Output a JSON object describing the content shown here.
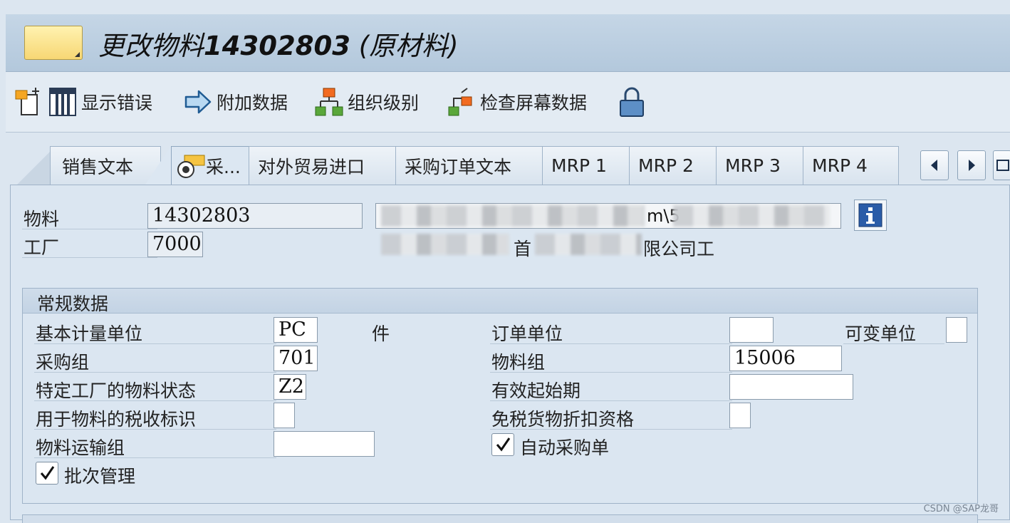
{
  "title": {
    "prefix": "更改物料",
    "material": "14302803",
    "suffix": "(原材料)"
  },
  "toolbar": {
    "show_errors": "显示错误",
    "additional_data": "附加数据",
    "org_levels": "组织级别",
    "check_screen": "检查屏幕数据"
  },
  "tabs": [
    "销售文本",
    "采...",
    "对外贸易进口",
    "采购订单文本",
    "MRP 1",
    "MRP 2",
    "MRP 3",
    "MRP 4"
  ],
  "header": {
    "material_label": "物料",
    "material_value": "14302803",
    "plant_label": "工厂",
    "plant_value": "7000",
    "desc_tail": "m\\5",
    "plant_desc_left": "首",
    "plant_desc_tail": "限公司工"
  },
  "general": {
    "title": "常规数据",
    "base_uom_label": "基本计量单位",
    "base_uom_value": "PC",
    "base_uom_text": "件",
    "order_unit_label": "订单单位",
    "order_unit_value": "",
    "var_unit_label": "可变单位",
    "purch_group_label": "采购组",
    "purch_group_value": "701",
    "mat_group_label": "物料组",
    "mat_group_value": "15006",
    "plant_status_label": "特定工厂的物料状态",
    "plant_status_value": "Z2",
    "valid_from_label": "有效起始期",
    "valid_from_value": "",
    "tax_ind_label": "用于物料的税收标识",
    "tax_ind_value": "",
    "tax_exempt_label": "免税货物折扣资格",
    "freight_label": "物料运输组",
    "freight_value": "",
    "auto_po_label": "自动采购单",
    "auto_po_checked": true,
    "batch_label": "批次管理",
    "batch_checked": true
  },
  "watermark": "CSDN @SAP龙哥"
}
